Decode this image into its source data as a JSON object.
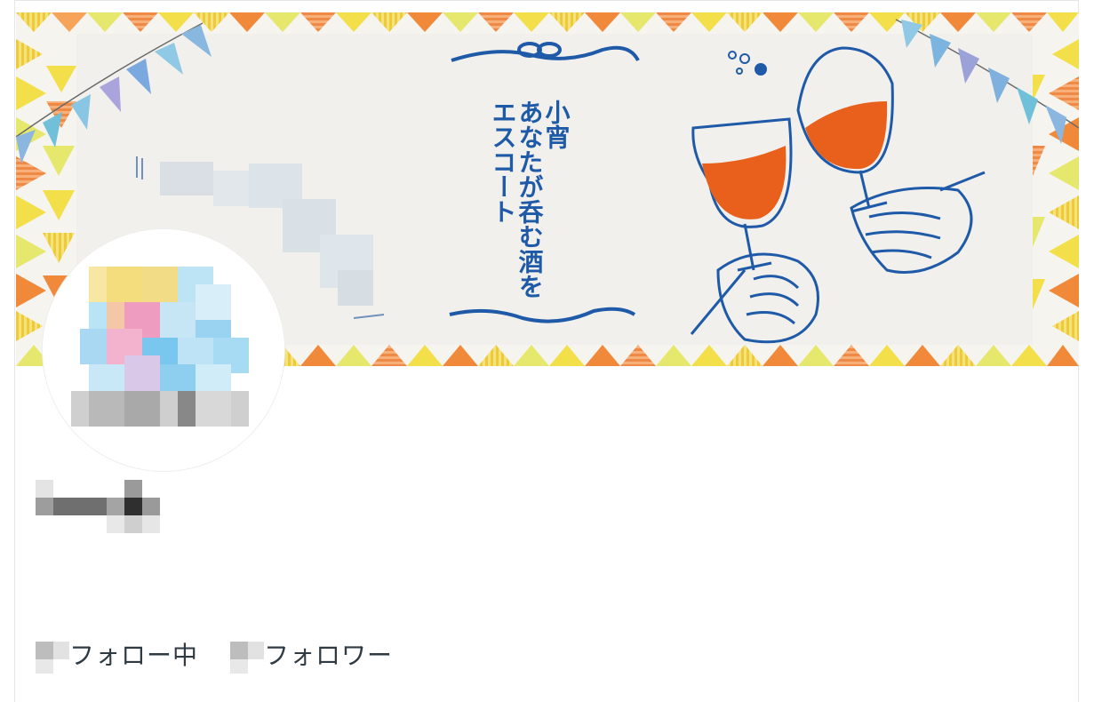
{
  "banner": {
    "title_line1": "小宵",
    "title_line2": "あなたが呑む酒を",
    "title_line3": "エスコート",
    "colors": {
      "paper": "#f1f0ec",
      "triangle_yellow": "#f2df4a",
      "triangle_orange": "#f08a3a",
      "triangle_lime": "#e4e86a",
      "wine": "#e8601c",
      "ink": "#1f5aa8"
    }
  },
  "profile": {
    "avatar": {
      "icon": "pixelated-avatar",
      "blurred": true
    },
    "name": {
      "blurred": true
    }
  },
  "stats": {
    "following": {
      "label": "フォロー中",
      "count_blurred": true
    },
    "followers": {
      "label": "フォロワー",
      "count_blurred": true
    }
  }
}
